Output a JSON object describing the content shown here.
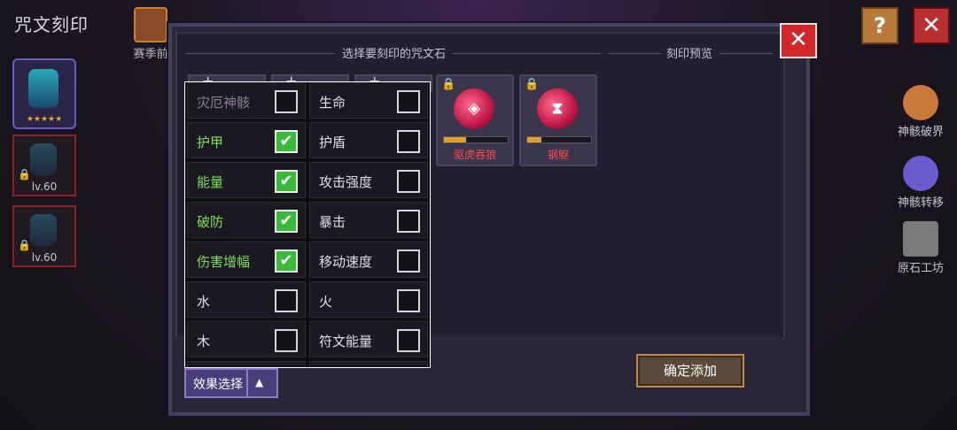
{
  "page_title": "咒文刻印",
  "season_label": "赛季前",
  "characters": [
    {
      "level": ""
    },
    {
      "level": "lv.60"
    },
    {
      "level": "lv.60"
    }
  ],
  "help_symbol": "?",
  "close_symbol": "✕",
  "side_menu": [
    {
      "label": "神骸破界",
      "color": "#c87a3a"
    },
    {
      "label": "神骸转移",
      "color": "#6a5ad0"
    },
    {
      "label": "原石工坊",
      "color": "#7a7a7a"
    }
  ],
  "dialog": {
    "select_header": "选择要刻印的咒文石",
    "preview_header": "刻印预览",
    "stones": [
      {
        "name": "驱虎吞狼",
        "symbol": "◈",
        "progress": 0.35
      },
      {
        "name": "钢躯",
        "symbol": "⧗",
        "progress": 0.22
      }
    ],
    "confirm_label": "确定添加"
  },
  "filter": {
    "items": [
      {
        "label": "灾厄神骸",
        "checked": false
      },
      {
        "label": "生命",
        "checked": false
      },
      {
        "label": "护甲",
        "checked": true
      },
      {
        "label": "护盾",
        "checked": false
      },
      {
        "label": "能量",
        "checked": true
      },
      {
        "label": "攻击强度",
        "checked": false
      },
      {
        "label": "破防",
        "checked": true
      },
      {
        "label": "暴击",
        "checked": false
      },
      {
        "label": "伤害增幅",
        "checked": true
      },
      {
        "label": "移动速度",
        "checked": false
      },
      {
        "label": "水",
        "checked": false
      },
      {
        "label": "火",
        "checked": false
      },
      {
        "label": "木",
        "checked": false
      },
      {
        "label": "符文能量",
        "checked": false
      }
    ],
    "check_mark": "✔",
    "button_label": "效果选择",
    "button_arrow": "▲"
  }
}
